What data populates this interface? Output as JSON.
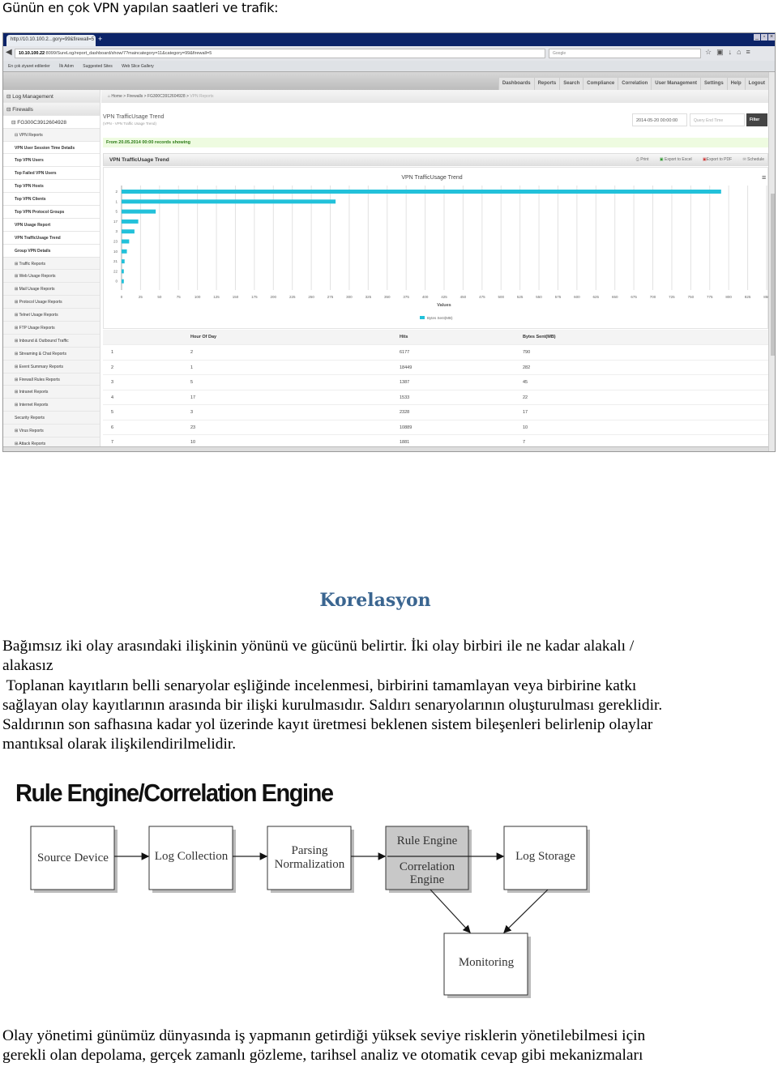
{
  "caption": "Günün en çok VPN yapılan saatleri ve trafik:",
  "browser": {
    "tab_title": "http://10.10.100.2...gory=99&firewall=5",
    "new_tab": "+",
    "address_host": "10.10.100.22",
    "address_path": ":8099/SureLog/report_dashboard/show/7?maincategory=11&category=99&firewall=5",
    "search_placeholder": "Google",
    "bookmarks": [
      "En çok ziyaret edilenler",
      "İlk Adım",
      "Suggested Sites",
      "Web Slice Gallery"
    ]
  },
  "app": {
    "top_nav": [
      "Dashboards",
      "Reports",
      "Search",
      "Compliance",
      "Correlation",
      "User Management",
      "Settings",
      "Help",
      "Logout"
    ],
    "breadcrumb": [
      "Home",
      "Firewalls",
      "FG300C3912604928",
      "VPN Reports"
    ],
    "sidebar": [
      {
        "label": "⊟ Log Management",
        "level": 0
      },
      {
        "label": "⊟ Firewalls",
        "level": 0
      },
      {
        "label": "⊟ FG300C3912604928",
        "level": 1
      },
      {
        "label": "⊟ VPN Reports",
        "level": 2
      },
      {
        "label": "VPN User Session Time Details",
        "level": 3
      },
      {
        "label": "Top VPN Users",
        "level": 3
      },
      {
        "label": "Top Failed VPN Users",
        "level": 3
      },
      {
        "label": "Top VPN Hosts",
        "level": 3
      },
      {
        "label": "Top VPN Clients",
        "level": 3
      },
      {
        "label": "Top VPN Protocol Groups",
        "level": 3
      },
      {
        "label": "VPN Usage Report",
        "level": 3
      },
      {
        "label": "VPN TrafficUsage Trend",
        "level": 3
      },
      {
        "label": "Group VPN Details",
        "level": 3
      },
      {
        "label": "⊞ Traffic Reports",
        "level": 2
      },
      {
        "label": "⊞ Web Usage Reports",
        "level": 2
      },
      {
        "label": "⊞ Mail Usage Reports",
        "level": 2
      },
      {
        "label": "⊞ Protocol Usage Reports",
        "level": 2
      },
      {
        "label": "⊞ Telnet Usage Reports",
        "level": 2
      },
      {
        "label": "⊞ FTP Usage Reports",
        "level": 2
      },
      {
        "label": "⊞ Inbound & Outbound Traffic",
        "level": 2
      },
      {
        "label": "⊞ Streaming & Chat Reports",
        "level": 2
      },
      {
        "label": "⊞ Event Summary Reports",
        "level": 2
      },
      {
        "label": "⊞ Firewall Rules Reports",
        "level": 2
      },
      {
        "label": "⊞ Intranet Reports",
        "level": 2
      },
      {
        "label": "⊞ Internet Reports",
        "level": 2
      },
      {
        "label": "Security Reports",
        "level": 2
      },
      {
        "label": "⊞ Virus Reports",
        "level": 2
      },
      {
        "label": "⊞ Attack Reports",
        "level": 2
      }
    ],
    "page_title": "VPN TrafficUsage Trend",
    "page_subtitle": "(VPN - VPN Traffic Usage Trend)",
    "start_time": "2014-05-20 00:00:00",
    "end_time_placeholder": "Query End Time",
    "filter_label": "Filter",
    "records_notice": "From 20.05.2014 00:00 records showing",
    "panel_title": "VPN TrafficUsage Trend",
    "tools": {
      "print": "Print",
      "excel": "Export to Excel",
      "pdf": "Export to PDF",
      "schedule": "Schedule"
    },
    "table": {
      "headers": [
        "",
        "Hour Of Day",
        "Hits",
        "Bytes Sent(MB)"
      ],
      "rows": [
        [
          "1",
          "2",
          "6177",
          "790"
        ],
        [
          "2",
          "1",
          "18449",
          "282"
        ],
        [
          "3",
          "5",
          "1387",
          "45"
        ],
        [
          "4",
          "17",
          "1533",
          "22"
        ],
        [
          "5",
          "3",
          "2328",
          "17"
        ],
        [
          "6",
          "23",
          "10889",
          "10"
        ],
        [
          "7",
          "10",
          "1881",
          "7"
        ]
      ]
    }
  },
  "chart_data": {
    "type": "bar",
    "orientation": "horizontal",
    "title": "VPN TrafficUsage Trend",
    "xlabel": "Values",
    "categories": [
      "2",
      "1",
      "5",
      "17",
      "3",
      "23",
      "10",
      "21",
      "22",
      "0"
    ],
    "series": [
      {
        "name": "Bytes Sent(MB)",
        "values": [
          790,
          282,
          45,
          22,
          17,
          10,
          7,
          4,
          3,
          3
        ]
      }
    ],
    "xlim": [
      0,
      850
    ],
    "x_ticks": [
      "0",
      "25",
      "50",
      "75",
      "100",
      "125",
      "150",
      "175",
      "200",
      "225",
      "250",
      "275",
      "300",
      "325",
      "350",
      "375",
      "400",
      "425",
      "450",
      "475",
      "500",
      "525",
      "550",
      "575",
      "600",
      "625",
      "650",
      "675",
      "700",
      "725",
      "750",
      "775",
      "800",
      "825",
      "850"
    ],
    "grid": true,
    "legend": "bottom",
    "bar_color": "#22c1da"
  },
  "heading": "Korelasyon",
  "paragraph_lines": [
    "Bağımsız iki olay arasındaki ilişkinin yönünü ve gücünü belirtir. İki olay birbiri ile ne kadar alakalı /",
    "alakasız",
    " Toplanan kayıtların belli senaryolar eşliğinde incelenmesi, birbirini tamamlayan veya birbirine katkı",
    "sağlayan olay kayıtlarının arasında bir ilişki kurulmasıdır. Saldırı senaryolarının oluşturulması gereklidir.",
    "Saldırının son safhasına kadar yol üzerinde kayıt üretmesi beklenen sistem bileşenleri belirlenip olaylar",
    "mantıksal olarak ilişkilendirilmelidir."
  ],
  "diagram": {
    "title": "Rule Engine/Correlation Engine",
    "nodes": {
      "source": "Source Device",
      "collection": "Log Collection",
      "parsing_1": "Parsing",
      "parsing_2": "Normalization",
      "rule": "Rule Engine",
      "corr_1": "Correlation",
      "corr_2": "Engine",
      "storage": "Log Storage",
      "monitoring": "Monitoring"
    }
  },
  "closing_lines": [
    "Olay yönetimi günümüz dünyasında iş yapmanın getirdiği yüksek seviye risklerin yönetilebilmesi için",
    "gerekli olan depolama, gerçek zamanlı gözleme, tarihsel analiz ve otomatik cevap gibi mekanizmaları"
  ]
}
